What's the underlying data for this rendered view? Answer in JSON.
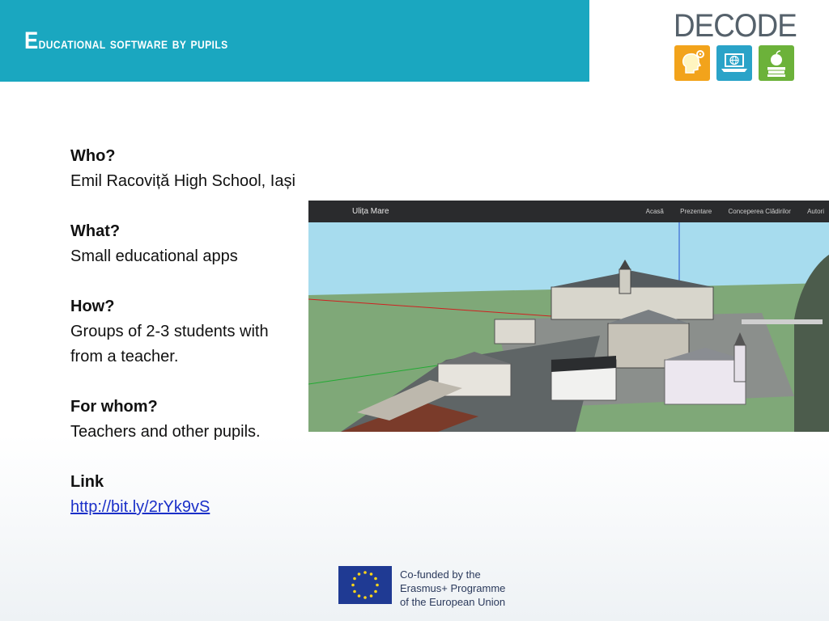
{
  "header": {
    "title_first_letter": "E",
    "title_rest": "ducational software by pupils",
    "bg_color": "#1aa7c0"
  },
  "logo": {
    "word": "DECODE",
    "tiles": [
      {
        "icon": "head-gear-icon",
        "color": "#f2a31b"
      },
      {
        "icon": "laptop-globe-icon",
        "color": "#2aa3c8"
      },
      {
        "icon": "apple-books-icon",
        "color": "#6cb23a"
      }
    ]
  },
  "content": {
    "who_label": "Who?",
    "who_value": "Emil Racoviță High School, Iași",
    "what_label": "What?",
    "what_value": "Small educational apps",
    "how_label": "How?",
    "how_value_line1": "Groups of 2-3 students with",
    "how_value_line2": "from a teacher.",
    "whom_label": "For whom?",
    "whom_value": "Teachers and other pupils.",
    "link_label": "Link",
    "link_value": "http://bit.ly/2rYk9vS"
  },
  "screenshot": {
    "brand": "Ulița Mare",
    "menu": [
      "Acasă",
      "Prezentare",
      "Conceperea Clădirilor",
      "Autori"
    ]
  },
  "footer": {
    "line1": "Co-funded by the",
    "line2": "Erasmus+ Programme",
    "line3": "of the European Union",
    "flag_color": "#1f3a93",
    "star_color": "#ffd617"
  }
}
